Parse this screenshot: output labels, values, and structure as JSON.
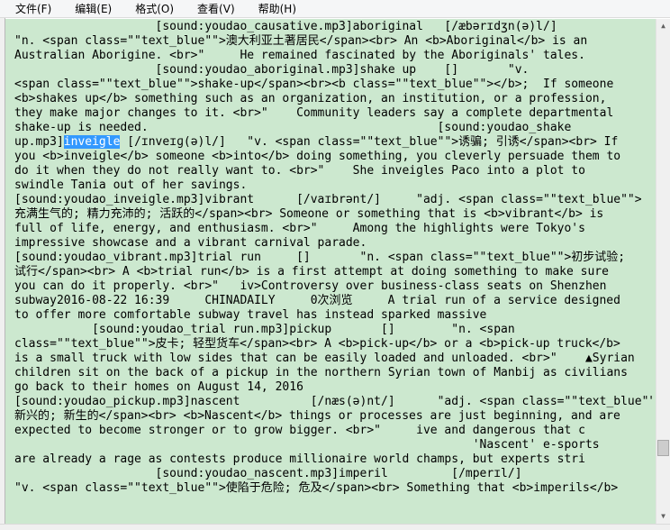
{
  "menu": [
    {
      "label": "文件(F)"
    },
    {
      "label": "编辑(E)"
    },
    {
      "label": "格式(O)"
    },
    {
      "label": "查看(V)"
    },
    {
      "label": "帮助(H)"
    }
  ],
  "editor": {
    "background": "#cce8cf",
    "selection_color": "#3399ff",
    "lines": [
      {
        "text": "                    [sound:youdao_causative.mp3]aboriginal   [/æbərɪdʒn(ə)l/]"
      },
      {
        "text": "\"n. <span class=\"\"text_blue\"\">澳大利亚土著居民</span><br> An <b>Aboriginal</b> is an"
      },
      {
        "text": "Australian Aborigine. <br>\"     He remained fascinated by the Aboriginals' tales."
      },
      {
        "text": "                    [sound:youdao_aboriginal.mp3]shake up    []       \"v."
      },
      {
        "text": "<span class=\"\"text_blue\"\">shake-up</span><br><b class=\"\"text_blue\"\"></b>;  If someone"
      },
      {
        "text": "<b>shakes up</b> something such as an organization, an institution, or a profession,"
      },
      {
        "text": "they make major changes to it. <br>\"    Community leaders say a complete departmental"
      },
      {
        "text": "shake-up is needed.                                         [sound:youdao_shake"
      },
      {
        "before": "up.mp3]",
        "selected": "inveigle",
        "after": " [/ɪnveɪɡ(ə)l/]   \"v. <span class=\"\"text_blue\"\">诱骗; 引诱</span><br> If"
      },
      {
        "text": "you <b>inveigle</b> someone <b>into</b> doing something, you cleverly persuade them to"
      },
      {
        "text": "do it when they do not really want to. <br>\"    She inveigles Paco into a plot to"
      },
      {
        "text": "swindle Tania out of her savings."
      },
      {
        "text": "[sound:youdao_inveigle.mp3]vibrant      [/vaɪbrənt/]     \"adj. <span class=\"\"text_blue\"\">"
      },
      {
        "text": "充满生气的; 精力充沛的; 活跃的</span><br> Someone or something that is <b>vibrant</b> is"
      },
      {
        "text": "full of life, energy, and enthusiasm. <br>\"     Among the highlights were Tokyo's"
      },
      {
        "text": "impressive showcase and a vibrant carnival parade."
      },
      {
        "text": "[sound:youdao_vibrant.mp3]trial run     []       \"n. <span class=\"\"text_blue\"\">初步试验;"
      },
      {
        "text": "试行</span><br> A <b>trial run</b> is a first attempt at doing something to make sure"
      },
      {
        "text": "you can do it properly. <br>\"   iv>Controversy over business-class seats on Shenzhen"
      },
      {
        "text": "subway2016-08-22 16:39     CHINADAILY     0次浏览     A trial run of a service designed"
      },
      {
        "text": "to offer more comfortable subway travel has instead sparked massive"
      },
      {
        "text": "           [sound:youdao_trial run.mp3]pickup       []        \"n. <span"
      },
      {
        "text": "class=\"\"text_blue\"\">皮卡; 轻型货车</span><br> A <b>pick-up</b> or a <b>pick-up truck</b>"
      },
      {
        "text": "is a small truck with low sides that can be easily loaded and unloaded. <br>\"    ▲Syrian"
      },
      {
        "text": "children sit on the back of a pickup in the northern Syrian town of Manbij as civilians"
      },
      {
        "text": "go back to their homes on August 14, 2016"
      },
      {
        "text": "[sound:youdao_pickup.mp3]nascent          [/næs(ə)nt/]      \"adj. <span class=\"\"text_blue\"\">"
      },
      {
        "text": "新兴的; 新生的</span><br> <b>Nascent</b> things or processes are just beginning, and are"
      },
      {
        "text": "expected to become stronger or to grow bigger. <br>\"     ive and dangerous that c"
      },
      {
        "text": "                                                                 'Nascent' e-sports"
      },
      {
        "text": "are already a rage as contests produce millionaire world champs, but experts stri"
      },
      {
        "text": "                    [sound:youdao_nascent.mp3]imperil         [/mperɪl/]"
      },
      {
        "text": "\"v. <span class=\"\"text_blue\"\">使陷于危险; 危及</span><br> Something that <b>imperils</b>"
      }
    ]
  },
  "scrollbar": {
    "up_icon": "arrow-up-icon",
    "down_icon": "arrow-down-icon",
    "up_glyph": "▲",
    "down_glyph": "▼"
  }
}
